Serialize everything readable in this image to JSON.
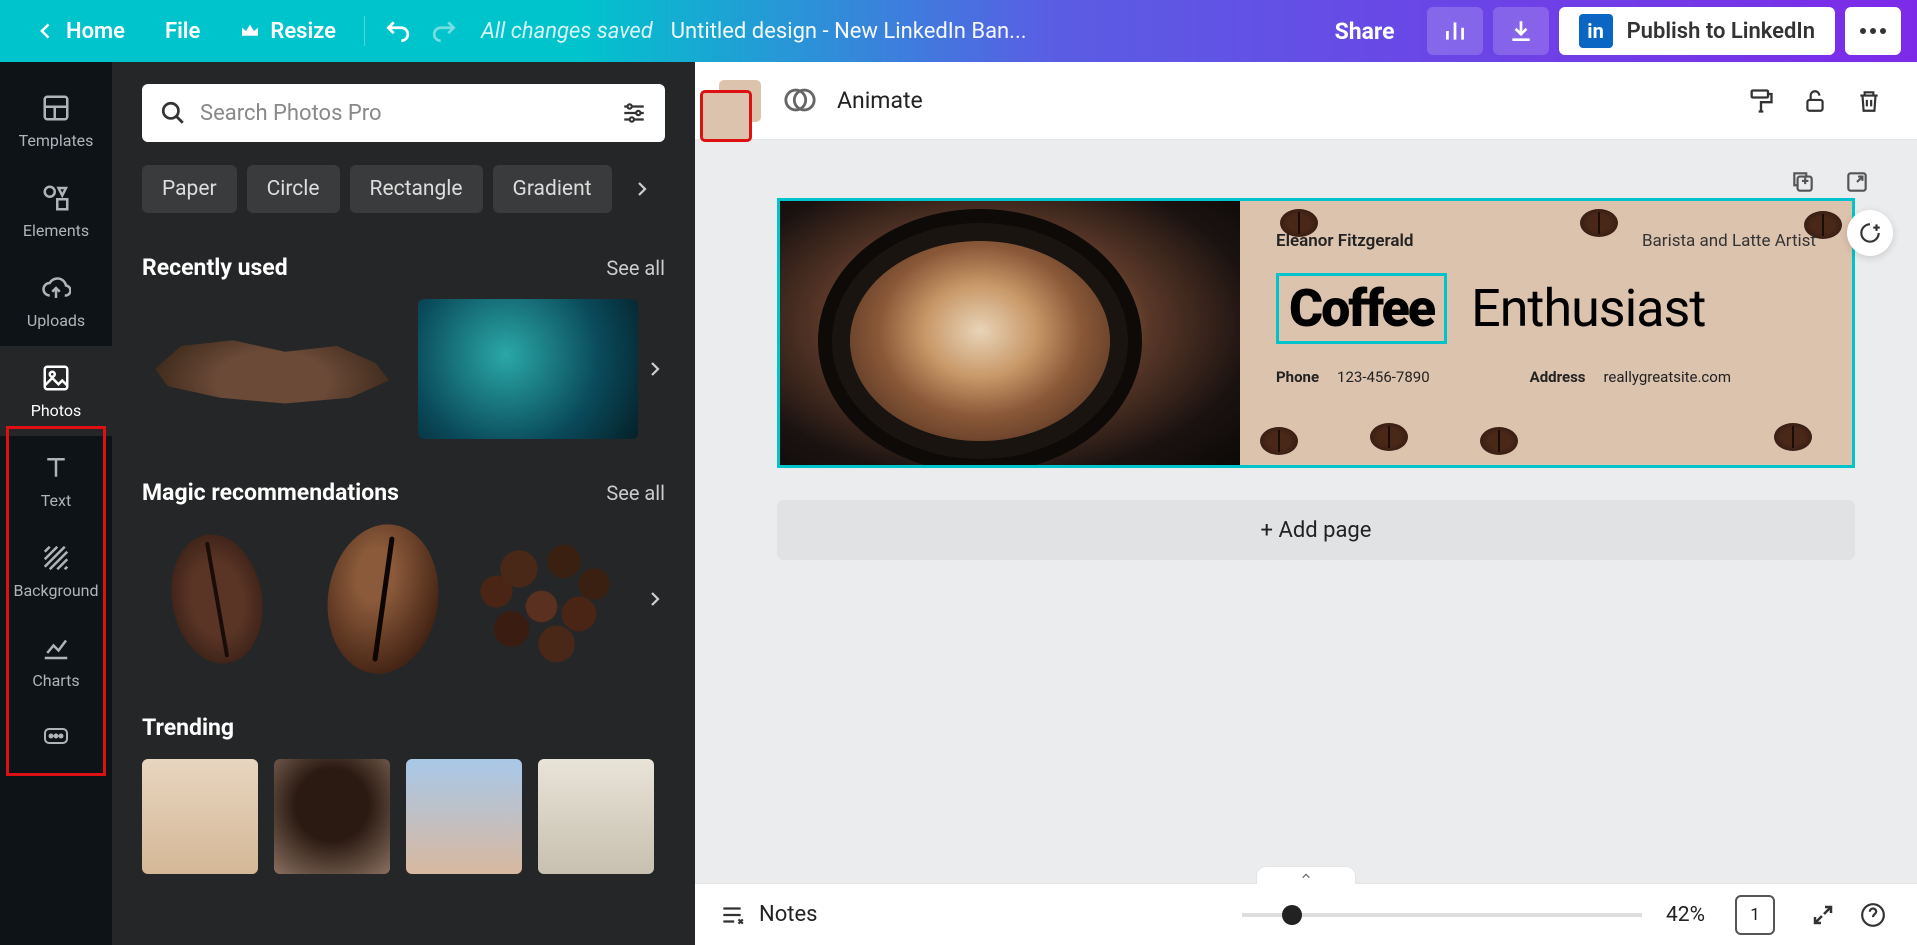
{
  "header": {
    "home": "Home",
    "file": "File",
    "resize": "Resize",
    "saved_status": "All changes saved",
    "doc_title": "Untitled design - New LinkedIn Ban...",
    "share": "Share",
    "publish": "Publish to LinkedIn",
    "linkedin_badge": "in"
  },
  "leftrail": {
    "items": [
      {
        "label": "Templates"
      },
      {
        "label": "Elements"
      },
      {
        "label": "Uploads"
      },
      {
        "label": "Photos"
      },
      {
        "label": "Text"
      },
      {
        "label": "Background"
      },
      {
        "label": "Charts"
      }
    ]
  },
  "sidepanel": {
    "search_placeholder": "Search Photos Pro",
    "chips": [
      "Paper",
      "Circle",
      "Rectangle",
      "Gradient"
    ],
    "sections": {
      "recent": {
        "title": "Recently used",
        "seeall": "See all"
      },
      "magic": {
        "title": "Magic recommendations",
        "seeall": "See all"
      },
      "trending": {
        "title": "Trending"
      }
    }
  },
  "ctxbar": {
    "bg_color": "#dcc3ae",
    "animate": "Animate"
  },
  "canvas": {
    "name": "Eleanor Fitzgerald",
    "role": "Barista and Latte Artist",
    "word1": "Coffee",
    "word2": "Enthusiast",
    "phone_label": "Phone",
    "phone_value": "123-456-7890",
    "address_label": "Address",
    "address_value": "reallygreatsite.com",
    "addpage": "+ Add page"
  },
  "bottombar": {
    "notes": "Notes",
    "zoom_pct": "42%",
    "page_count": "1"
  }
}
